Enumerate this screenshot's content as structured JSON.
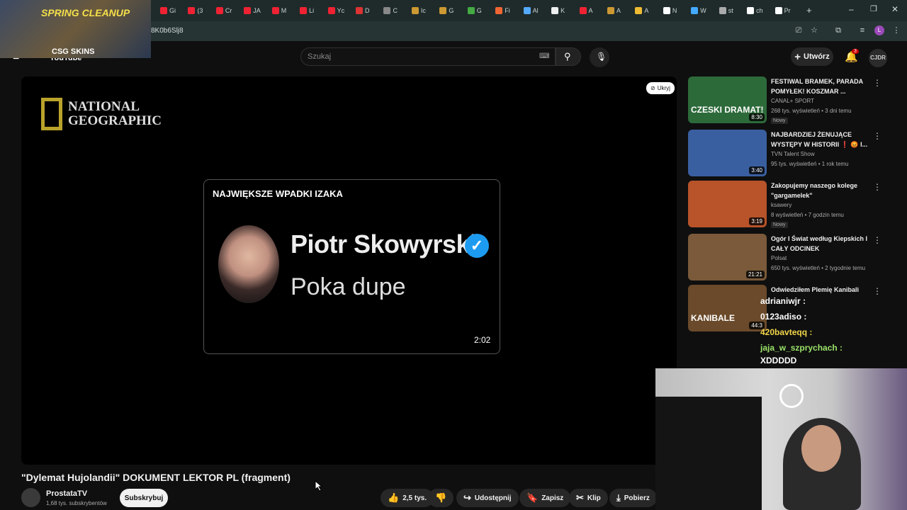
{
  "browser": {
    "tabs": [
      "Gi",
      "(3",
      "Cr",
      "JA",
      "M",
      "Li",
      "Yc",
      "D",
      "C",
      "Ic",
      "G",
      "G",
      "Fi",
      "Al",
      "K",
      "A",
      "A",
      "A",
      "N",
      "W",
      "st",
      "ch",
      "Pr"
    ],
    "url": "8K0b6Slj8"
  },
  "sponsor": {
    "title": "SPRING CLEANUP",
    "brand": "CSG SKINS"
  },
  "youtube": {
    "logo": "YouTube",
    "search_placeholder": "Szukaj",
    "create_label": "Utwórz",
    "notifications_count": "3",
    "account_initials": "CJDR"
  },
  "player": {
    "watermark": "NATIONAL GEOGRAPHIC",
    "hide_label": "Ukryj",
    "card": {
      "title": "NAJWIĘKSZE WPADKI IZAKA",
      "name": "Piotr Skowyrski",
      "subtitle": "Poka dupe",
      "duration": "2:02"
    }
  },
  "video": {
    "title": "\"Dylemat Hujolandii\" DOKUMENT LEKTOR PL (fragment)",
    "channel": "ProstataTV",
    "subscribers": "1,68 tys. subskrybentów",
    "subscribe_label": "Subskrybuj",
    "likes": "2,5 tys.",
    "share_label": "Udostępnij",
    "save_label": "Zapisz",
    "clip_label": "Klip",
    "download_label": "Pobierz"
  },
  "recommendations": [
    {
      "title": "FESTIWAL BRAMEK, PARADA POMYŁEK! KOSZMAR ...",
      "channel": "CANAL+ SPORT",
      "meta": "268 tys. wyświetleń • 3 dni temu",
      "badge": "Nowy",
      "duration": "8:30",
      "thumb_text": "CZESKI DRAMAT!"
    },
    {
      "title": "NAJBARDZIEJ ŻENUJĄCE WYSTĘPY W HISTORII ❗ 😡 I...",
      "channel": "TVN Talent Show",
      "meta": "95 tys. wyświetleń • 1 rok temu",
      "badge": "",
      "duration": "3:40",
      "thumb_text": ""
    },
    {
      "title": "Zakopujemy naszego kolege \"gargamelek\"",
      "channel": "ksawery",
      "meta": "8 wyświetleń • 7 godzin temu",
      "badge": "Nowy",
      "duration": "3:19",
      "thumb_text": ""
    },
    {
      "title": "Ogór I Świat według Kiepskich I CAŁY ODCINEK",
      "channel": "Polsat",
      "meta": "650 tys. wyświetleń • 2 tygodnie temu",
      "badge": "",
      "duration": "21:21",
      "thumb_text": ""
    },
    {
      "title": "Odwiedziłem Plemię Kanibali",
      "channel": "",
      "meta": "",
      "badge": "",
      "duration": "44:3",
      "thumb_text": "KANIBALE"
    }
  ],
  "chat": [
    {
      "user": "adrianiwjr :",
      "message": "",
      "color": "#ffffff"
    },
    {
      "user": "0123adiso :",
      "message": "",
      "color": "#ffffff"
    },
    {
      "user": "420bavteqq :",
      "message": "",
      "color": "#f2d64a"
    },
    {
      "user": "jaja_w_szprychach :",
      "message": "XDDDDD",
      "color": "#9be36a"
    }
  ]
}
